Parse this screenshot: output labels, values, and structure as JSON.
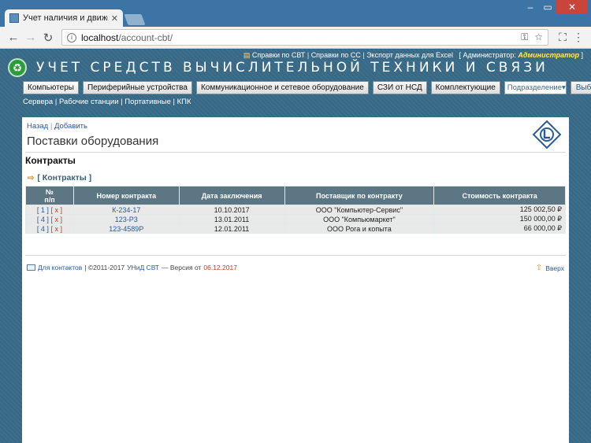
{
  "browser": {
    "tab_title": "Учет наличия и движен",
    "url_host": "localhost",
    "url_path": "/account-cbt/"
  },
  "header": {
    "links": [
      "Справки по СВТ",
      "Справки по СС",
      "Экспорт данных для Excel"
    ],
    "admin_prefix": "[ Администратор:",
    "admin_name": "Администратор",
    "admin_suffix": "]",
    "site_title": "УЧЕТ СРЕДСТВ ВЫЧИСЛИТЕЛЬНОЙ ТЕХНИКИ И СВЯЗИ"
  },
  "menu": {
    "items": [
      "Компьютеры",
      "Периферийные устройства",
      "Коммуникационное и сетевое оборудование",
      "СЗИ от НСД",
      "Комплектующие"
    ],
    "select_value": "Подразделение",
    "go_label": "Выбор",
    "submenu": [
      "Сервера",
      "Рабочие станции",
      "Портативные",
      "КПК"
    ]
  },
  "page": {
    "back": "Назад",
    "add": "Добавить",
    "title": "Поставки оборудования",
    "section": "Контракты",
    "subsection": "[ Контракты ]"
  },
  "table": {
    "headers": [
      "№ п/п",
      "Номер контракта",
      "Дата заключения",
      "Поставщик по контракту",
      "Стоимость контракта"
    ],
    "rows": [
      {
        "num": "[ 1 ]",
        "del": "[ x ]",
        "contract": "К-234-17",
        "date": "10.10.2017",
        "supplier": "ООО \"Компьютер-Сервис\"",
        "cost": "125 002,50 ₽"
      },
      {
        "num": "[ 4 ]",
        "del": "[ x ]",
        "contract": "123-Р3",
        "date": "13.01.2011",
        "supplier": "ООО \"Компьюмаркет\"",
        "cost": "150 000,00 ₽"
      },
      {
        "num": "[ 4 ]",
        "del": "[ x ]",
        "contract": "123-4589Р",
        "date": "12.01.2011",
        "supplier": "ООО Рога и копыта",
        "cost": "66 000,00 ₽"
      }
    ]
  },
  "footer": {
    "contacts": "Для контактов",
    "copyright": "| ©2011-2017",
    "org": "УНиД СВТ",
    "version_prefix": "— Версия от",
    "version_date": "06.12.2017",
    "to_top": "Вверх"
  }
}
